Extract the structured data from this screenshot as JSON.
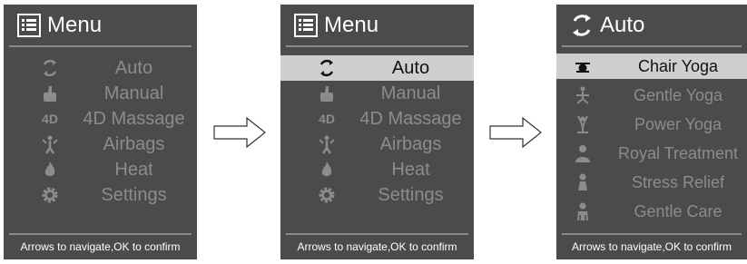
{
  "screen1": {
    "title": "Menu",
    "title_icon": "list-icon",
    "items": [
      {
        "label": "Auto",
        "icon": "refresh-icon"
      },
      {
        "label": "Manual",
        "icon": "thumb-icon"
      },
      {
        "label": "4D Massage",
        "icon": "4d-icon",
        "icon_text": "4D"
      },
      {
        "label": "Airbags",
        "icon": "airbag-person-icon"
      },
      {
        "label": "Heat",
        "icon": "flame-icon"
      },
      {
        "label": "Settings",
        "icon": "gear-icon"
      }
    ],
    "footer": "Arrows to navigate,OK to confirm"
  },
  "screen2": {
    "title": "Menu",
    "title_icon": "list-icon",
    "selected": "Auto",
    "items": [
      {
        "label": "Auto",
        "icon": "refresh-icon"
      },
      {
        "label": "Manual",
        "icon": "thumb-icon"
      },
      {
        "label": "4D Massage",
        "icon": "4d-icon",
        "icon_text": "4D"
      },
      {
        "label": "Airbags",
        "icon": "airbag-person-icon"
      },
      {
        "label": "Heat",
        "icon": "flame-icon"
      },
      {
        "label": "Settings",
        "icon": "gear-icon"
      }
    ],
    "footer": "Arrows to navigate,OK to confirm"
  },
  "screen3": {
    "title": "Auto",
    "title_icon": "refresh-icon",
    "selected": "Chair Yoga",
    "items": [
      {
        "label": "Chair Yoga",
        "icon": "chair-yoga-icon"
      },
      {
        "label": "Gentle Yoga",
        "icon": "yoga-pose-icon"
      },
      {
        "label": "Power Yoga",
        "icon": "power-yoga-icon"
      },
      {
        "label": "Royal Treatment",
        "icon": "person-icon"
      },
      {
        "label": "Stress Relief",
        "icon": "stress-relief-icon"
      },
      {
        "label": "Gentle Care",
        "icon": "care-icon"
      }
    ],
    "footer": "Arrows to navigate,OK to confirm"
  },
  "colors": {
    "screen_bg": "#4b4b4b",
    "selected_bg": "#cfcfcf",
    "inactive_text": "#8c8c8c",
    "title_text": "#ffffff"
  }
}
